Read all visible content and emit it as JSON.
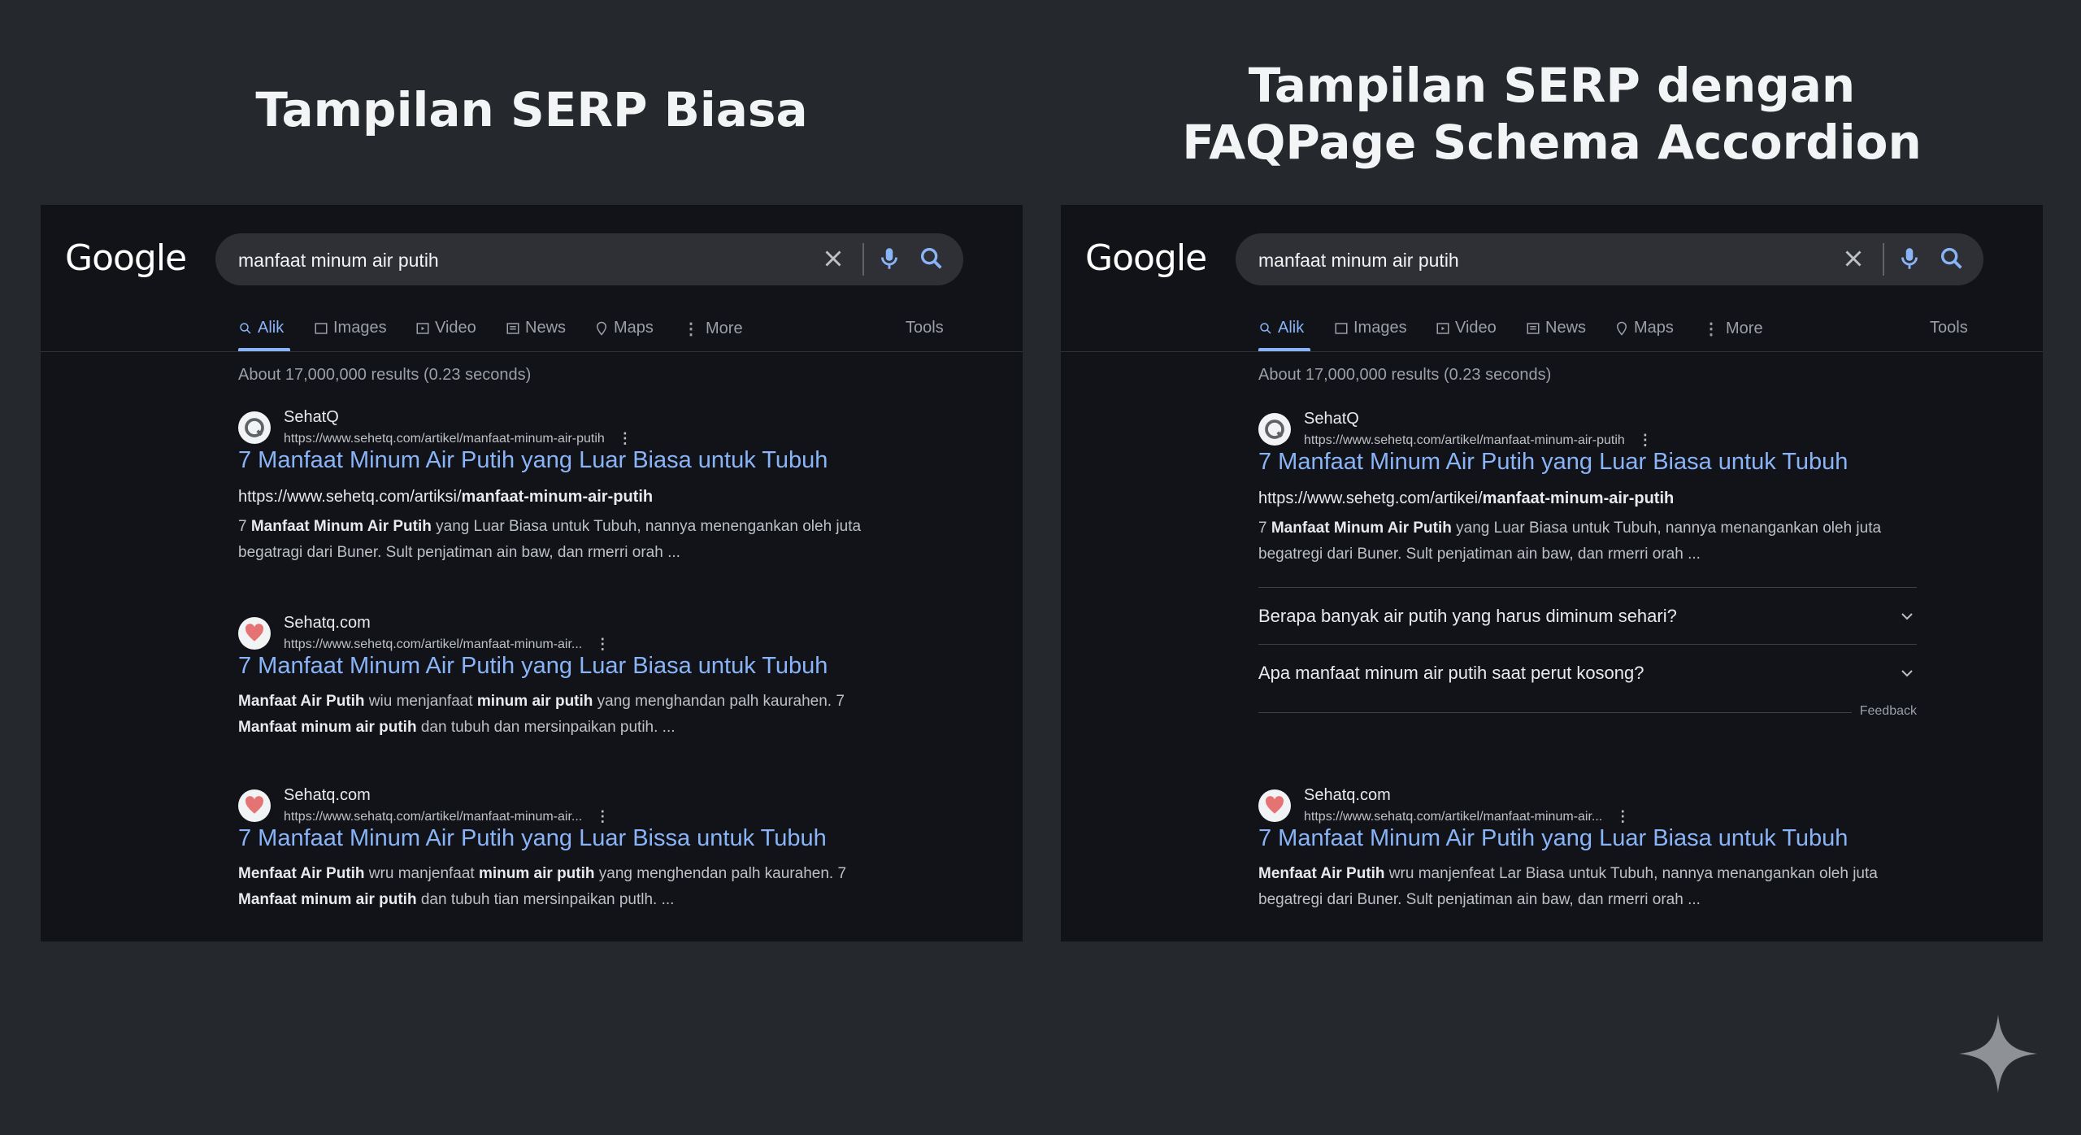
{
  "left": {
    "heading": "Tampilan SERP Biasa",
    "logo": "Google",
    "query": "manfaat minum air putih",
    "tabs": [
      "Alik",
      "Images",
      "Video",
      "News",
      "Maps",
      "More",
      "Tools"
    ],
    "stats": "About 17,000,000 results (0.23 seconds)",
    "results": [
      {
        "site": "SehatQ",
        "url": "https://www.sehetq.com/artikel/manfaat-minum-air-putih",
        "title": "7 Manfaat Minum Air Putih yang Luar Biasa untuk Tubuh",
        "display_url_prefix": "https://www.sehetq.com/artiksi/",
        "display_url_bold": "manfaat-minum-air-putih",
        "s1_b1": "Manfaat Minum Air Putih",
        "s1_pre": "7 ",
        "s1_rest": " yang Luar Biasa untuk Tubuh, nannya menengankan oleh juta",
        "s2": "begatragi dari Buner. Sult penjatiman ain baw, dan rmerri orah ..."
      },
      {
        "site": "Sehatq.com",
        "url": "https://www.sehetq.com/artikel/manfaat-minum-air...",
        "title": "7 Manfaat Minum Air Putih yang Luar Biasa untuk Tubuh",
        "s1_b1": "Manfaat Air Putih",
        "s1_t1": " wiu menjanfaat ",
        "s1_b2": "minum air putih",
        "s1_t2": " yang menghandan palh kaurahen. 7",
        "s2_b1": "Manfaat minum air putih",
        "s2_t1": " dan tubuh dan mersinpaikan putih. ..."
      },
      {
        "site": "Sehatq.com",
        "url": "https://www.sehatq.com/artikel/manfaat-minum-air...",
        "title": "7 Manfaat Minum Air Putih yang Luar Bissa untuk Tubuh",
        "s1_b1": "Menfaat Air Putih",
        "s1_t1": " wru manjenfaat ",
        "s1_b2": "minum air putih",
        "s1_t2": " yang menghendan palh kaurahen. 7",
        "s2_b1": "Manfaat minum air putih",
        "s2_t1": " dan tubuh tian mersinpaikan putlh. ..."
      }
    ]
  },
  "right": {
    "heading_line1": "Tampilan SERP dengan",
    "heading_line2": "FAQPage Schema Accordion",
    "logo": "Google",
    "query": "manfaat minum air putih",
    "tabs": [
      "Alik",
      "Images",
      "Video",
      "News",
      "Maps",
      "More",
      "Tools"
    ],
    "stats": "About 17,000,000 results (0.23 seconds)",
    "result1": {
      "site": "SehatQ",
      "url": "https://www.sehetq.com/artikel/manfaat-minum-air-putih",
      "title": "7 Manfaat Minum Air Putih yang Luar Biasa untuk Tubuh",
      "display_url_prefix": "https://www.sehetg.com/artikei/",
      "display_url_bold": "manfaat-minum-air-putih",
      "s1_pre": "7 ",
      "s1_b1": "Manfaat Minum Air Putih",
      "s1_rest": " yang Luar Biasa untuk Tubuh, nannya menangankan oleh juta",
      "s2": "begatregi dari Buner. Sult penjatiman ain baw, dan rmerri orah ..."
    },
    "faq": [
      "Berapa banyak air putih yang harus diminum sehari?",
      "Apa manfaat minum air putih saat perut kosong?"
    ],
    "feedback": "Feedback",
    "result2": {
      "site": "Sehatq.com",
      "url": "https://www.sehatq.com/artikel/manfaat-minum-air...",
      "title": "7 Manfaat Minum Air Putih yang Luar Biasa untuk Tubuh",
      "s1_b1": "Menfaat Air Putih",
      "s1_t1": " wru manjenfeat Lar Biasa untuk Tubuh, nannya menangankan oleh juta",
      "s2": "begatregi dari Buner. Sult penjatiman ain baw, dan rmerri orah ..."
    }
  },
  "colors": {
    "background": "#25282d",
    "panel": "#111318",
    "link": "#8ab4f8",
    "text": "#e8eaed",
    "muted": "#9aa0a6"
  },
  "icons": [
    "close-icon",
    "microphone-icon",
    "search-icon",
    "sparkle-icon"
  ]
}
